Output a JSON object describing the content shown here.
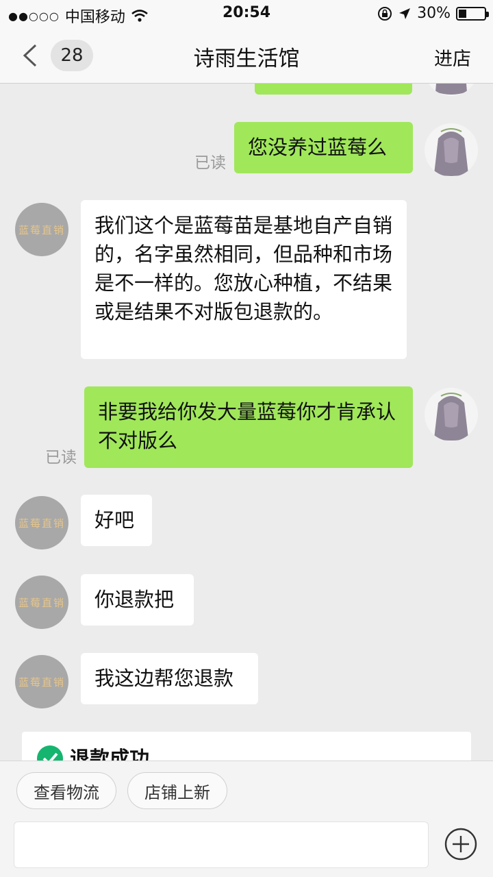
{
  "status_bar": {
    "signal": "●●○○○",
    "carrier": "中国移动",
    "time": "20:54",
    "battery": "30%",
    "battery_level": 0.3
  },
  "nav": {
    "unread_count": "28",
    "title": "诗雨生活馆",
    "enter_shop": "进店"
  },
  "shop_avatar_text": "蓝莓直销",
  "messages": [
    {
      "from": "me",
      "text": "您没养过蓝莓么",
      "read": "已读"
    },
    {
      "from": "shop",
      "text": "我们这个是蓝莓苗是基地自产自销的，名字虽然相同，但品种和市场是不一样的。您放心种植，不结果或是结果不对版包退款的。"
    },
    {
      "from": "me",
      "text": "非要我给你发大量蓝莓你才肯承认不对版么",
      "read": "已读"
    },
    {
      "from": "shop",
      "text": "好吧"
    },
    {
      "from": "shop",
      "text": "你退款把"
    },
    {
      "from": "shop",
      "text": "我这边帮您退款"
    }
  ],
  "refund_card": {
    "title": "退款成功"
  },
  "quick_replies": [
    "查看物流",
    "店铺上新"
  ],
  "colors": {
    "my_bubble": "#a0e75a",
    "background": "#ececec",
    "success": "#15b56f"
  }
}
